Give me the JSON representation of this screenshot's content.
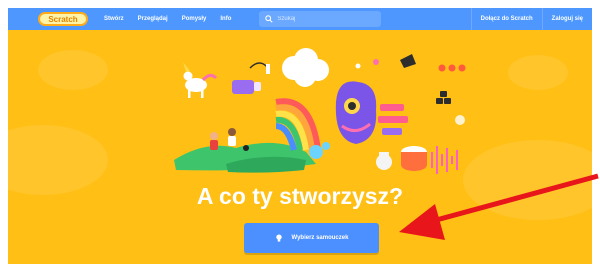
{
  "navbar": {
    "logo_text": "Scratch",
    "links": [
      "Stwórz",
      "Przeglądaj",
      "Pomysły",
      "Info"
    ],
    "search_placeholder": "Szukaj",
    "join_label": "Dołącz do Scratch",
    "signin_label": "Zaloguj się"
  },
  "hero": {
    "headline": "A co ty stworzysz?",
    "cta_label": "Wybierz samouczek"
  },
  "colors": {
    "navbar": "#4d97ff",
    "hero_background": "#ffbf14",
    "cta": "#4c8fff",
    "annotation_arrow": "#e8161b"
  }
}
